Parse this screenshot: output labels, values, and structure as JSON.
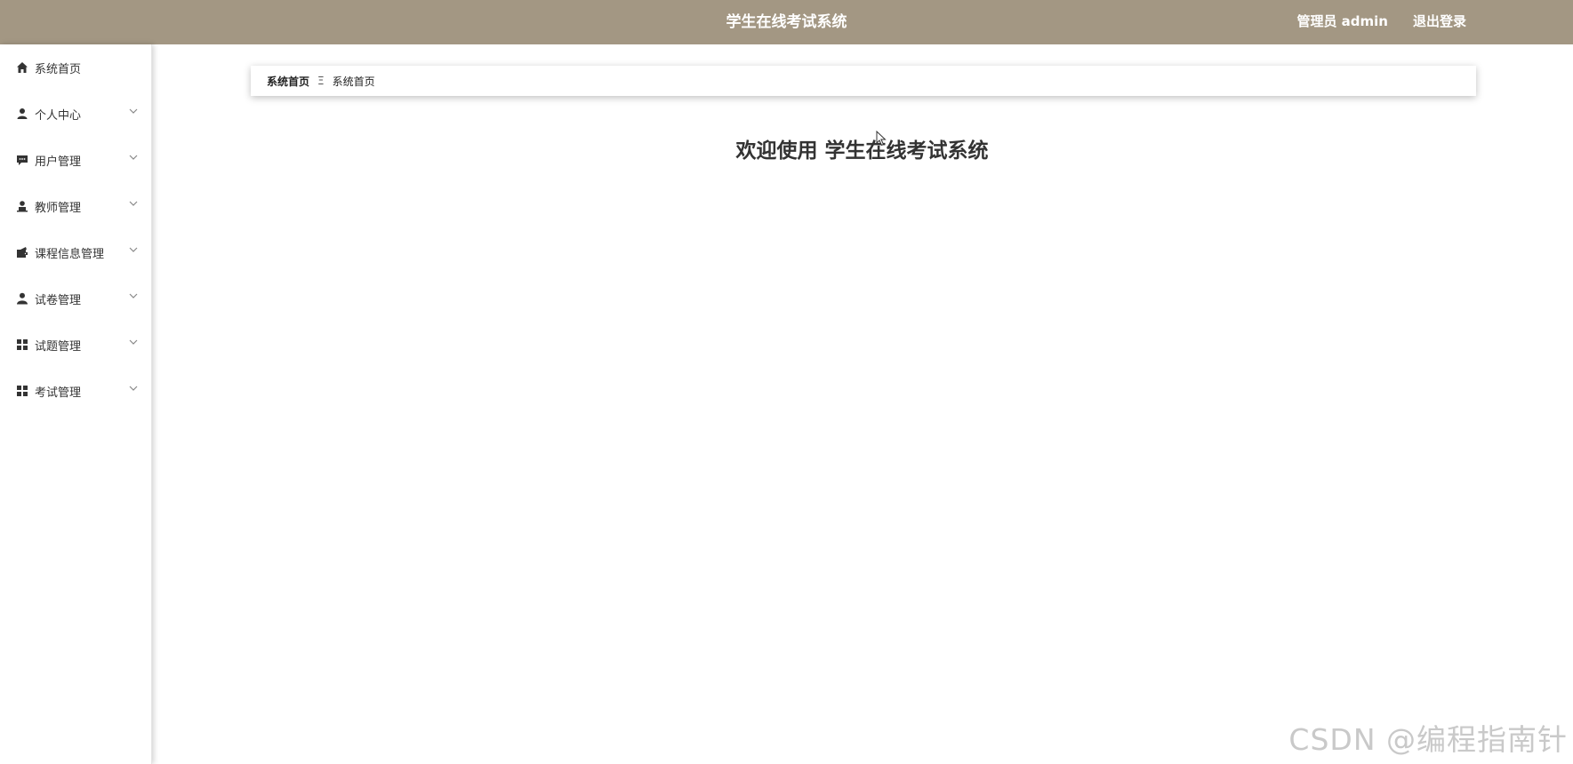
{
  "header": {
    "title": "学生在线考试系统",
    "user_label": "管理员 admin",
    "logout_label": "退出登录",
    "background_color": "#a39783"
  },
  "sidebar": {
    "items": [
      {
        "label": "系统首页",
        "icon": "home-icon",
        "expandable": false
      },
      {
        "label": "个人中心",
        "icon": "user-icon",
        "expandable": true
      },
      {
        "label": "用户管理",
        "icon": "chat-icon",
        "expandable": true
      },
      {
        "label": "教师管理",
        "icon": "teacher-icon",
        "expandable": true
      },
      {
        "label": "课程信息管理",
        "icon": "wallet-icon",
        "expandable": true
      },
      {
        "label": "试卷管理",
        "icon": "person-icon",
        "expandable": true
      },
      {
        "label": "试题管理",
        "icon": "grid-icon",
        "expandable": true
      },
      {
        "label": "考试管理",
        "icon": "grid-icon",
        "expandable": true
      }
    ]
  },
  "breadcrumb": {
    "home": "系统首页",
    "separator": "Ξ",
    "current": "系统首页"
  },
  "main": {
    "welcome_text": "欢迎使用 学生在线考试系统"
  },
  "watermark": "CSDN @编程指南针"
}
